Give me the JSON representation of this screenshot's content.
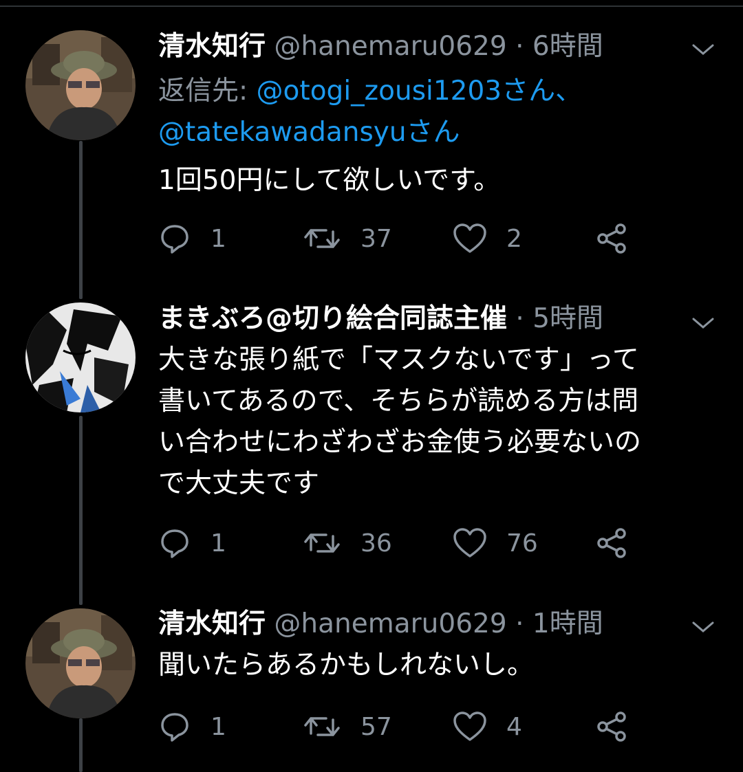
{
  "colors": {
    "background": "#000000",
    "text": "#ffffff",
    "muted": "#8b949e",
    "mention": "#1d9bf0",
    "thread_line": "#3d4146"
  },
  "tweets": [
    {
      "name": "清水知行",
      "handle": "@hanemaru0629",
      "dot": "·",
      "time": "6時間",
      "reply_prefix": "返信先: ",
      "mention_1": "@otogi_zousi1203さん、",
      "mention_2": "@tatekawadansyuさん",
      "text": "1回50円にして欲しいです。",
      "replies": "1",
      "retweets": "37",
      "likes": "2",
      "icons": [
        "chevron-down-icon",
        "reply-icon",
        "retweet-icon",
        "heart-icon",
        "share-icon"
      ]
    },
    {
      "name": "まきぶろ@切り絵合同誌主催",
      "dot": "·",
      "time": "5時間",
      "text_lines": [
        "大きな張り紙で「マスクないです」って",
        "書いてあるので、そちらが読める方は問",
        "い合わせにわざわざお金使う必要ないの",
        "で大丈夫です"
      ],
      "replies": "1",
      "retweets": "36",
      "likes": "76"
    },
    {
      "name": "清水知行",
      "handle": "@hanemaru0629",
      "dot": "·",
      "time": "1時間",
      "text": "聞いたらあるかもしれないし。",
      "replies": "1",
      "retweets": "57",
      "likes": "4"
    }
  ]
}
